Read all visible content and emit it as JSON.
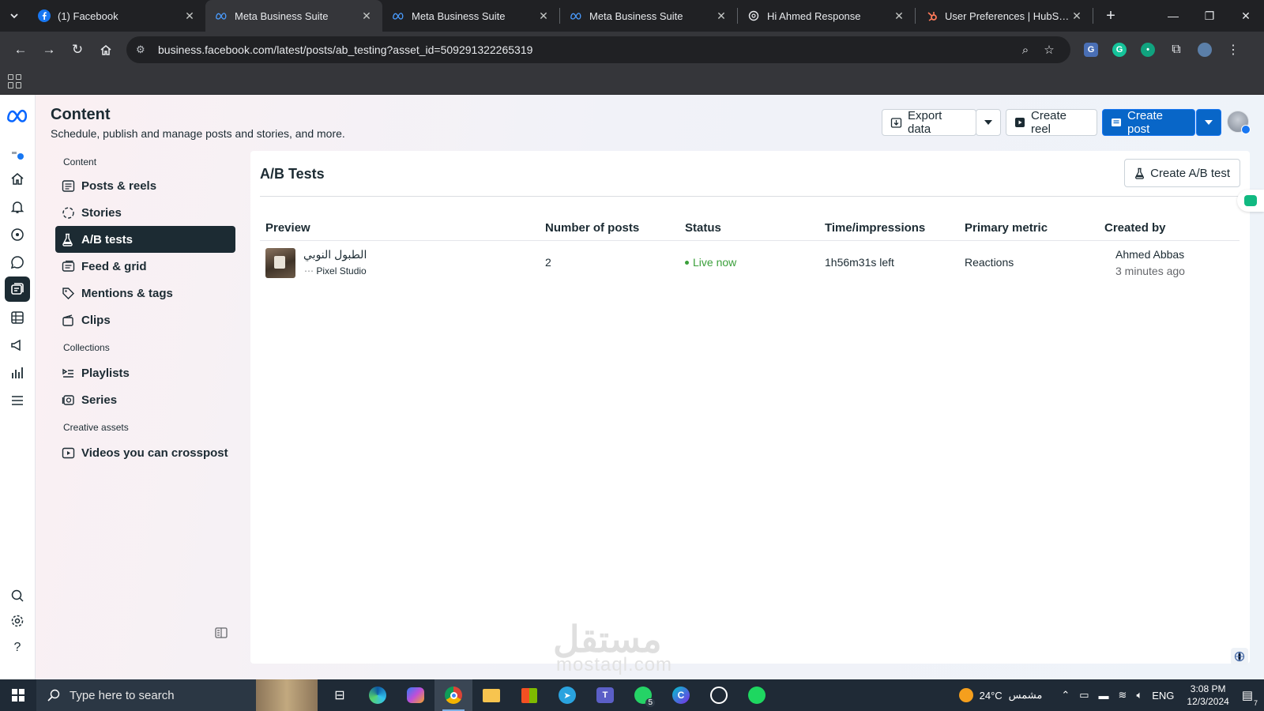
{
  "browser": {
    "tabs": [
      {
        "title": "(1) Facebook",
        "icon": "facebook-icon",
        "active": false
      },
      {
        "title": "Meta Business Suite",
        "icon": "meta-icon",
        "active": true
      },
      {
        "title": "Meta Business Suite",
        "icon": "meta-icon",
        "active": false
      },
      {
        "title": "Meta Business Suite",
        "icon": "meta-icon",
        "active": false
      },
      {
        "title": "Hi Ahmed Response",
        "icon": "openai-icon",
        "active": false
      },
      {
        "title": "User Preferences | HubSpot",
        "icon": "hubspot-icon",
        "active": false
      }
    ],
    "url": "business.facebook.com/latest/posts/ab_testing?asset_id=509291322265319"
  },
  "header": {
    "title": "Content",
    "subtitle": "Schedule, publish and manage posts and stories, and more.",
    "export_label": "Export data",
    "create_reel_label": "Create reel",
    "create_post_label": "Create post"
  },
  "sidebar": {
    "sections": [
      {
        "label": "Content"
      },
      {
        "label": "Collections"
      },
      {
        "label": "Creative assets"
      }
    ],
    "items": [
      {
        "label": "Posts & reels",
        "icon": "posts-icon"
      },
      {
        "label": "Stories",
        "icon": "stories-icon"
      },
      {
        "label": "A/B tests",
        "icon": "flask-icon",
        "active": true
      },
      {
        "label": "Feed & grid",
        "icon": "feed-icon"
      },
      {
        "label": "Mentions & tags",
        "icon": "tag-icon"
      },
      {
        "label": "Clips",
        "icon": "clips-icon"
      },
      {
        "label": "Playlists",
        "icon": "playlist-icon"
      },
      {
        "label": "Series",
        "icon": "series-icon"
      },
      {
        "label": "Videos you can crosspost",
        "icon": "video-icon"
      }
    ]
  },
  "main": {
    "title": "A/B Tests",
    "create_button": "Create A/B test",
    "columns": [
      "Preview",
      "Number of posts",
      "Status",
      "Time/impressions",
      "Primary metric",
      "Created by"
    ],
    "rows": [
      {
        "title": "الطبول النوبي",
        "page": "Pixel Studio",
        "posts": "2",
        "status": "Live now",
        "time": "1h56m31s left",
        "metric": "Reactions",
        "creator": "Ahmed Abbas",
        "created": "3 minutes ago"
      }
    ]
  },
  "watermark": {
    "text": "مستقل",
    "sub": "mostaql.com"
  },
  "taskbar": {
    "search_placeholder": "Type here to search",
    "whatsapp_badge": "5",
    "weather_temp": "24°C",
    "weather_text": "مشمس",
    "language": "ENG",
    "time": "3:08 PM",
    "date": "12/3/2024",
    "notifications": "7"
  },
  "colors": {
    "accent": "#0866c8",
    "nav_active": "#1c2b33",
    "live": "#3a9f3a"
  }
}
